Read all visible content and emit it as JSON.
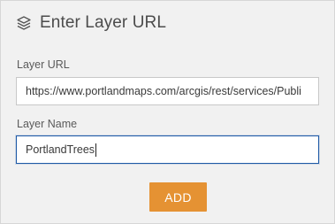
{
  "dialog": {
    "title": "Enter Layer URL",
    "icon": "layers-icon"
  },
  "fields": {
    "layer_url": {
      "label": "Layer URL",
      "value": "https://www.portlandmaps.com/arcgis/rest/services/Publi"
    },
    "layer_name": {
      "label": "Layer Name",
      "value": "PortlandTrees"
    }
  },
  "actions": {
    "add_label": "ADD"
  },
  "colors": {
    "accent": "#e59233",
    "focus_border": "#1f5aa6",
    "background": "#f1f1f1"
  }
}
